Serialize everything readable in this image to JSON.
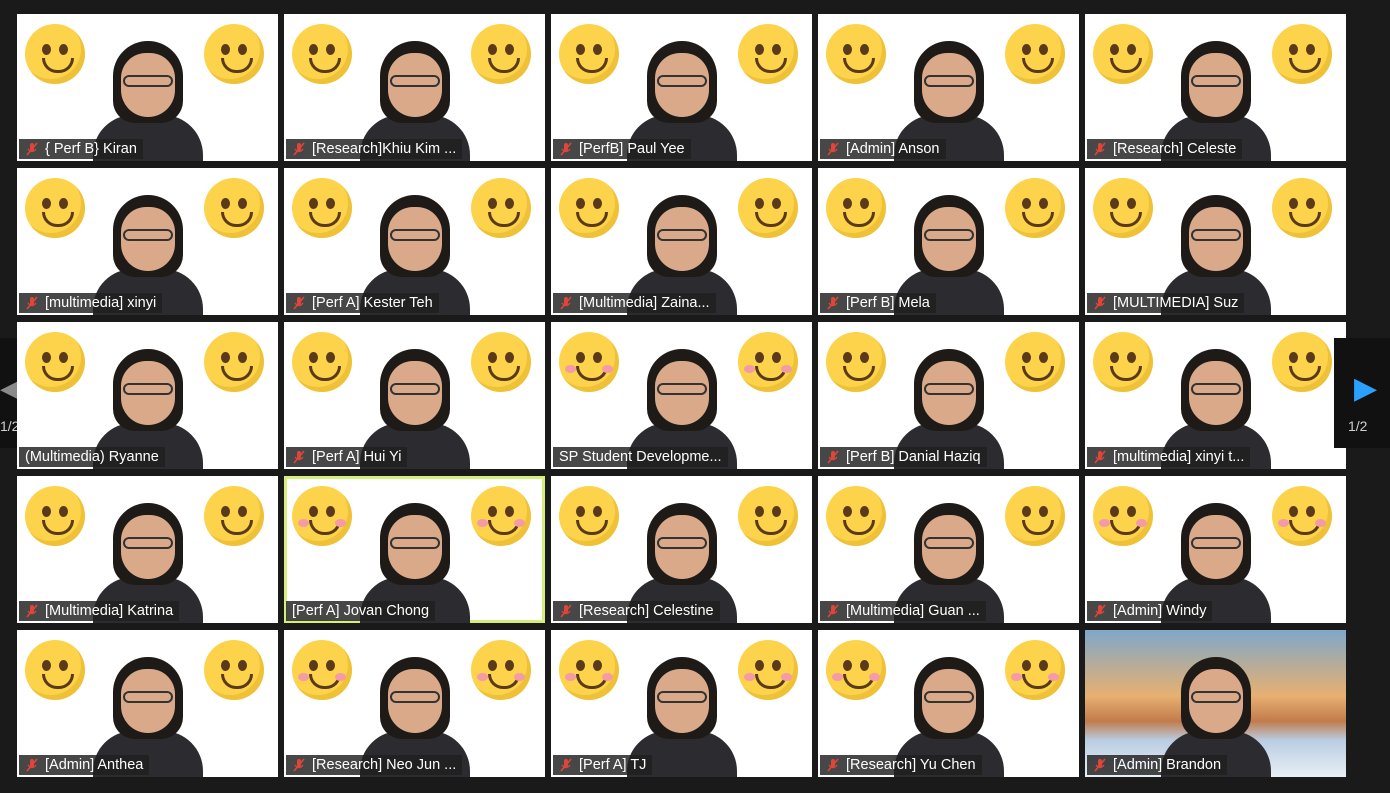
{
  "pagination": {
    "current": "1/2"
  },
  "colors": {
    "accent": "#2aa1ff",
    "active_speaker_border": "#d6ef7c",
    "muted_icon": "#e0453a"
  },
  "participants": [
    {
      "name": "{ Perf B} Kiran",
      "muted": true
    },
    {
      "name": "[Research]Khiu Kim ...",
      "muted": true
    },
    {
      "name": "[PerfB] Paul Yee",
      "muted": true
    },
    {
      "name": "[Admin] Anson",
      "muted": true
    },
    {
      "name": "[Research] Celeste",
      "muted": true
    },
    {
      "name": "[multimedia] xinyi",
      "muted": true
    },
    {
      "name": "[Perf A] Kester Teh",
      "muted": true
    },
    {
      "name": "[Multimedia] Zaina...",
      "muted": true
    },
    {
      "name": "[Perf B] Mela",
      "muted": true
    },
    {
      "name": "[MULTIMEDIA] Suz",
      "muted": true
    },
    {
      "name": "(Multimedia) Ryanne",
      "muted": false
    },
    {
      "name": "[Perf A] Hui Yi",
      "muted": true
    },
    {
      "name": "SP Student Developme...",
      "muted": false
    },
    {
      "name": "[Perf B] Danial Haziq",
      "muted": true
    },
    {
      "name": "[multimedia] xinyi t...",
      "muted": true
    },
    {
      "name": "[Multimedia] Katrina",
      "muted": true
    },
    {
      "name": "[Perf A] Jovan Chong",
      "muted": false,
      "active_speaker": true
    },
    {
      "name": "[Research] Celestine",
      "muted": true
    },
    {
      "name": "[Multimedia] Guan ...",
      "muted": true
    },
    {
      "name": "[Admin] Windy",
      "muted": true
    },
    {
      "name": "[Admin] Anthea",
      "muted": true
    },
    {
      "name": "[Research] Neo Jun ...",
      "muted": true
    },
    {
      "name": "[Perf A] TJ",
      "muted": true
    },
    {
      "name": "[Research] Yu Chen",
      "muted": true
    },
    {
      "name": "[Admin] Brandon",
      "muted": true
    }
  ]
}
